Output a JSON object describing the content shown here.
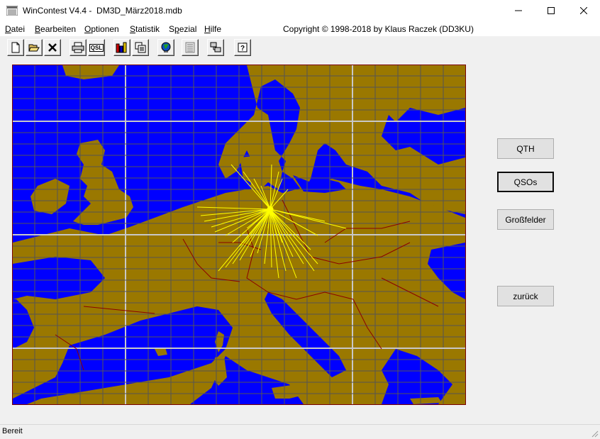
{
  "window": {
    "title": "WinContest V4.4 -  DM3D_März2018.mdb",
    "minimize_icon": "minimize-icon",
    "maximize_icon": "maximize-icon",
    "close_icon": "close-icon"
  },
  "menu": {
    "items": [
      {
        "key": "D",
        "rest": "atei"
      },
      {
        "key": "B",
        "rest": "earbeiten"
      },
      {
        "key": "O",
        "rest": "ptionen"
      },
      {
        "key": "S",
        "rest": "tatistik"
      },
      {
        "pre": "S",
        "key": "p",
        "rest": "ezial"
      },
      {
        "key": "H",
        "rest": "ilfe"
      }
    ],
    "copyright": "Copyright © 1998-2018 by Klaus Raczek (DD3KU)"
  },
  "toolbar": {
    "buttons": [
      "new-file-icon",
      "open-folder-icon",
      "delete-icon",
      "print-icon",
      "qsl-icon",
      "statistics-chart-icon",
      "copy-windows-icon",
      "globe-icon",
      "list-icon",
      "network-computer-icon",
      "help-icon"
    ],
    "qsl_label": "QSL"
  },
  "map": {
    "land_color": "#9a7800",
    "sea_color": "#0000ff",
    "grid_color": "#555555",
    "major_grid_color": "#c8c8c8",
    "border_color": "#8b0000",
    "path_color": "#ffff00"
  },
  "buttons": {
    "qth": "QTH",
    "qsos": "QSOs",
    "grossfelder": "Großfelder",
    "zurueck": "zurück"
  },
  "status": {
    "text": "Bereit"
  }
}
